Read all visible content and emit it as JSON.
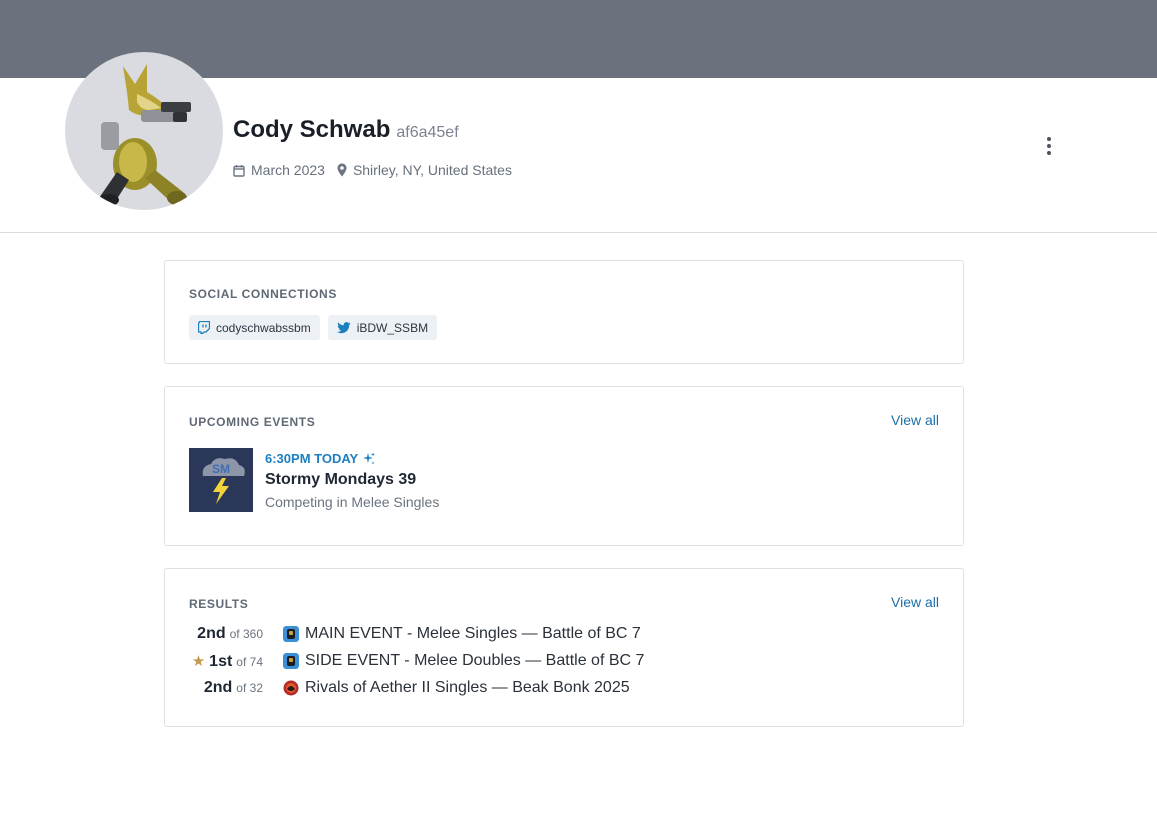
{
  "profile": {
    "name": "Cody Schwab",
    "id": "af6a45ef",
    "joined": "March 2023",
    "location": "Shirley, NY, United States"
  },
  "social": {
    "title": "SOCIAL CONNECTIONS",
    "twitch": "codyschwabssbm",
    "twitter": "iBDW_SSBM"
  },
  "events": {
    "title": "UPCOMING EVENTS",
    "view_all": "View all",
    "item": {
      "time": "6:30PM TODAY",
      "name": "Stormy Mondays 39",
      "sub": "Competing in Melee Singles",
      "thumb_text": "SM"
    }
  },
  "results": {
    "title": "RESULTS",
    "view_all": "View all",
    "rows": [
      {
        "place": "2nd",
        "of": "of 360",
        "name": "MAIN EVENT - Melee Singles — Battle of BC 7"
      },
      {
        "place": "1st",
        "of": "of 74",
        "name": "SIDE EVENT - Melee Doubles — Battle of BC 7"
      },
      {
        "place": "2nd",
        "of": "of 32",
        "name": "Rivals of Aether II Singles — Beak Bonk 2025"
      }
    ]
  },
  "colors": {
    "banner": "#6b727d",
    "accent": "#1b7fc0",
    "star": "#c49a4a"
  },
  "icons": [
    "calendar-icon",
    "location-pin-icon",
    "more-vertical-icon",
    "twitch-icon",
    "twitter-icon",
    "sparkle-icon",
    "star-icon",
    "melee-game-icon",
    "rivals-game-icon"
  ]
}
